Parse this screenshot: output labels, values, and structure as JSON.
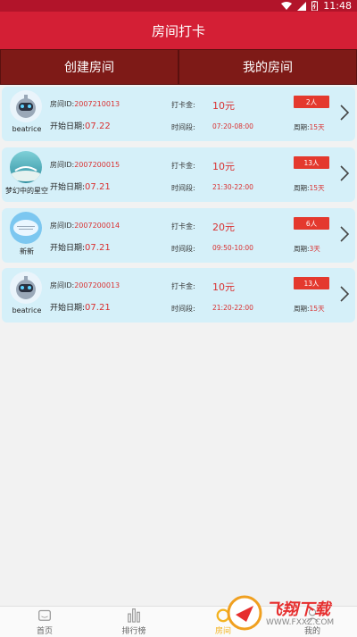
{
  "status_bar": {
    "time": "11:48"
  },
  "header": {
    "title": "房间打卡"
  },
  "tabs": [
    {
      "label": "创建房间"
    },
    {
      "label": "我的房间"
    }
  ],
  "labels": {
    "room_id_prefix": "房间ID:",
    "start_date_prefix": "开始日期:",
    "fee_label": "打卡金:",
    "time_label": "时间段:",
    "cycle_prefix": "周期:"
  },
  "rooms": [
    {
      "nickname": "beatrice",
      "avatar": "robot-avatar",
      "room_id": "2007210013",
      "start_date": "07.22",
      "fee": "10元",
      "people": "2人",
      "time_range": "07:20-08:00",
      "cycle": "15天"
    },
    {
      "nickname": "梦幻中的星空",
      "avatar": "sky-avatar",
      "room_id": "2007200015",
      "start_date": "07.21",
      "fee": "10元",
      "people": "13人",
      "time_range": "21:30-22:00",
      "cycle": "15天"
    },
    {
      "nickname": "新新",
      "avatar": "cloud-avatar",
      "room_id": "2007200014",
      "start_date": "07.21",
      "fee": "20元",
      "people": "6人",
      "time_range": "09:50-10:00",
      "cycle": "3天"
    },
    {
      "nickname": "beatrice",
      "avatar": "robot-avatar",
      "room_id": "2007200013",
      "start_date": "07.21",
      "fee": "10元",
      "people": "13人",
      "time_range": "21:20-22:00",
      "cycle": "15天"
    }
  ],
  "navbar": [
    {
      "label": "首页",
      "icon": "home-icon"
    },
    {
      "label": "排行榜",
      "icon": "chart-icon"
    },
    {
      "label": "房间",
      "icon": "room-icon",
      "active": true
    },
    {
      "label": "我的",
      "icon": "user-icon"
    }
  ],
  "watermark": {
    "brand": "飞翔下载",
    "url": "WWW.FXXZ.COM"
  },
  "colors": {
    "header": "#d41f35",
    "tabs": "#7e1a17",
    "card": "#d5f0f9",
    "accent_red": "#d93030",
    "badge": "#e4392e",
    "nav_active": "#f3b21f"
  }
}
